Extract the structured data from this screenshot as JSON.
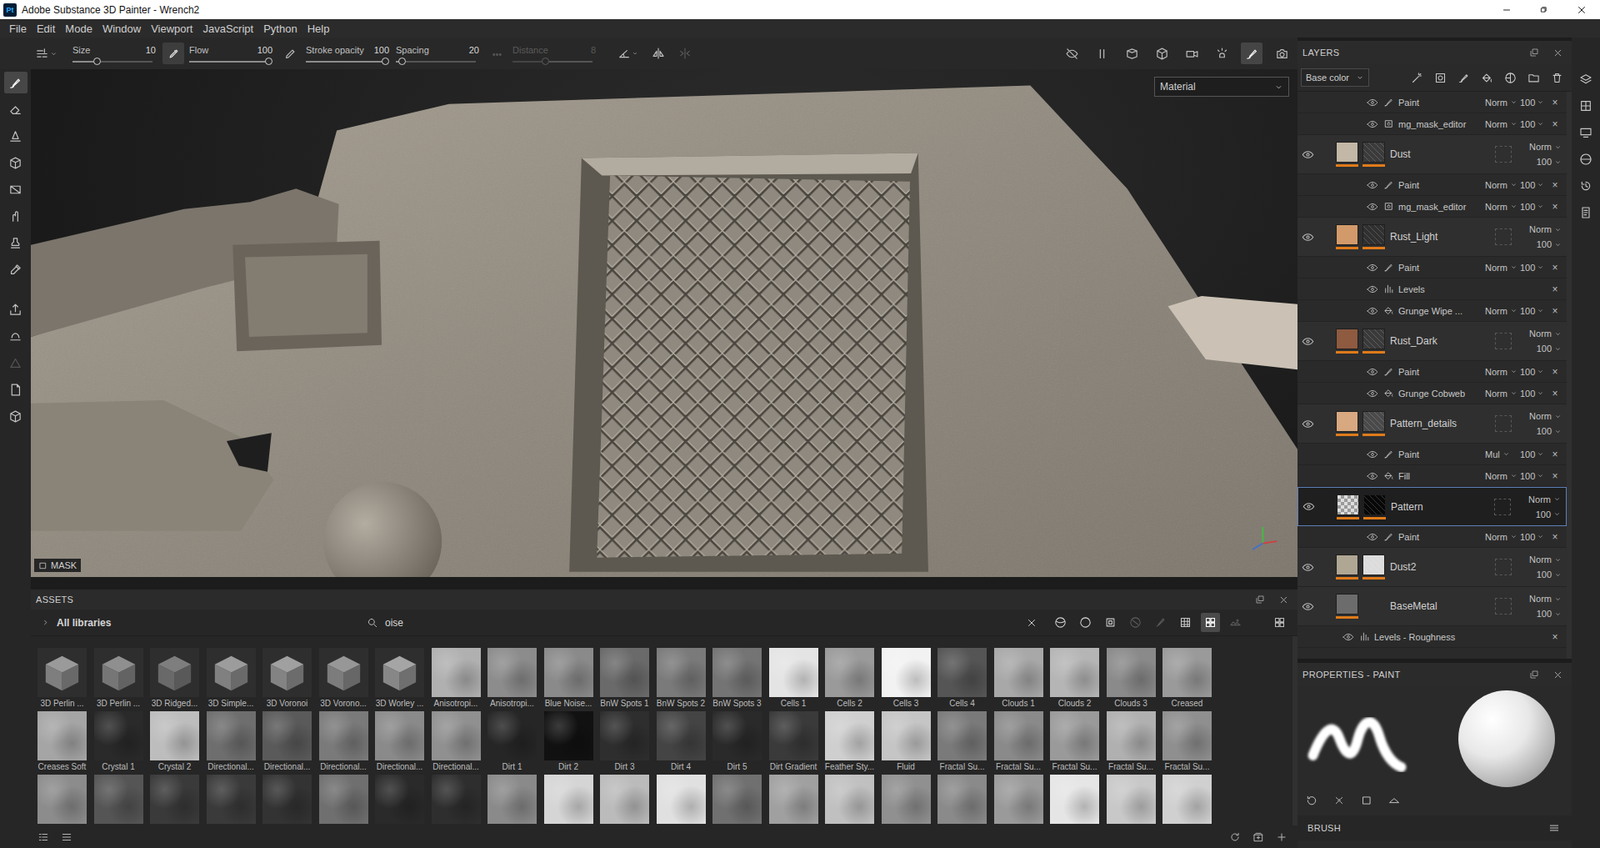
{
  "window": {
    "title": "Adobe Substance 3D Painter - Wrench2",
    "logo": "Pt"
  },
  "menu": [
    "File",
    "Edit",
    "Mode",
    "Window",
    "Viewport",
    "JavaScript",
    "Python",
    "Help"
  ],
  "toolbar": {
    "sliders": [
      {
        "label": "Size",
        "value": "10",
        "level": 0.31,
        "disabled": false,
        "toggle": null
      },
      {
        "label": "Flow",
        "value": "100",
        "level": 1,
        "disabled": false,
        "toggle": true
      },
      {
        "label": "Stroke opacity",
        "value": "100",
        "level": 1,
        "disabled": false,
        "toggle": false
      },
      {
        "label": "Spacing",
        "value": "20",
        "level": 0.08,
        "disabled": false,
        "toggle": null
      },
      {
        "label": "Distance",
        "value": "8",
        "level": 0.42,
        "disabled": true,
        "toggle": false
      }
    ],
    "extras": [
      {
        "disabled": false
      },
      {
        "disabled": false
      },
      {
        "disabled": true
      }
    ],
    "view_tools": [
      {
        "selected": false
      },
      {
        "selected": false
      },
      {
        "selected": false
      },
      {
        "selected": false
      },
      {
        "selected": false
      },
      {
        "selected": false
      },
      {
        "selected": true
      },
      {
        "selected": false
      }
    ]
  },
  "tools": [
    {
      "selected": true,
      "disabled": false
    },
    {
      "selected": false,
      "disabled": false
    },
    {
      "selected": false,
      "disabled": false
    },
    {
      "selected": false,
      "disabled": false
    },
    {
      "selected": false,
      "disabled": false
    },
    {
      "selected": false,
      "disabled": false
    },
    {
      "selected": false,
      "disabled": false
    },
    {
      "selected": false,
      "disabled": false
    },
    {
      "selected": false,
      "disabled": false
    },
    {
      "selected": false,
      "disabled": false
    },
    {
      "selected": false,
      "disabled": true
    },
    {
      "selected": false,
      "disabled": false
    },
    {
      "selected": false,
      "disabled": false
    }
  ],
  "viewport": {
    "mode": "Material",
    "mask_label": "MASK"
  },
  "assets": {
    "title": "ASSETS",
    "library": "All libraries",
    "search": "oise",
    "filters": [
      {
        "selected": false,
        "disabled": false
      },
      {
        "selected": false,
        "disabled": false
      },
      {
        "selected": false,
        "disabled": false
      },
      {
        "selected": false,
        "disabled": true
      },
      {
        "selected": false,
        "disabled": true
      },
      {
        "selected": false,
        "disabled": false
      },
      {
        "selected": true,
        "disabled": false
      },
      {
        "selected": false,
        "disabled": true
      }
    ],
    "items": [
      {
        "label": "3D Perlin ...",
        "color": "#9a9a9a",
        "kind": "3d"
      },
      {
        "label": "3D Perlin ...",
        "color": "#8f8f8f",
        "kind": "3d"
      },
      {
        "label": "3D Ridged...",
        "color": "#7e7e7e",
        "kind": "3d"
      },
      {
        "label": "3D Simple...",
        "color": "#9c9c9c",
        "kind": "3d"
      },
      {
        "label": "3D Voronoi",
        "color": "#a0a0a0",
        "kind": "3d"
      },
      {
        "label": "3D Vorono...",
        "color": "#979797",
        "kind": "3d"
      },
      {
        "label": "3D Worley ...",
        "color": "#a5a5a5",
        "kind": "3d"
      },
      {
        "label": "Anisotropi...",
        "color": "#b0b0b0",
        "kind": "2d"
      },
      {
        "label": "Anisotropi...",
        "color": "#8c8c8c",
        "kind": "2d"
      },
      {
        "label": "Blue Noise...",
        "color": "#8a8a8a",
        "kind": "2d"
      },
      {
        "label": "BnW Spots 1",
        "color": "#6a6a6a",
        "kind": "2d"
      },
      {
        "label": "BnW Spots 2",
        "color": "#7a7a7a",
        "kind": "2d"
      },
      {
        "label": "BnW Spots 3",
        "color": "#747474",
        "kind": "2d"
      },
      {
        "label": "Cells 1",
        "color": "#e4e4e4",
        "kind": "2d"
      },
      {
        "label": "Cells 2",
        "color": "#9a9a9a",
        "kind": "2d"
      },
      {
        "label": "Cells 3",
        "color": "#f2f2f2",
        "kind": "2d"
      },
      {
        "label": "Cells 4",
        "color": "#555555",
        "kind": "2d"
      },
      {
        "label": "Clouds 1",
        "color": "#a8a8a8",
        "kind": "2d"
      },
      {
        "label": "Clouds 2",
        "color": "#b5b5b5",
        "kind": "2d"
      },
      {
        "label": "Clouds 3",
        "color": "#8a8a8a",
        "kind": "2d"
      },
      {
        "label": "Creased",
        "color": "#9a9a9a",
        "kind": "2d"
      },
      {
        "label": "Creases Soft",
        "color": "#a5a5a5",
        "kind": "2d"
      },
      {
        "label": "Crystal 1",
        "color": "#2a2a2a",
        "kind": "2d"
      },
      {
        "label": "Crystal 2",
        "color": "#bdbdbd",
        "kind": "2d"
      },
      {
        "label": "Directional...",
        "color": "#6e6e6e",
        "kind": "2d"
      },
      {
        "label": "Directional...",
        "color": "#5a5a5a",
        "kind": "2d"
      },
      {
        "label": "Directional...",
        "color": "#7a7a7a",
        "kind": "2d"
      },
      {
        "label": "Directional...",
        "color": "#8a8a8a",
        "kind": "2d"
      },
      {
        "label": "Directional...",
        "color": "#909090",
        "kind": "2d"
      },
      {
        "label": "Dirt 1",
        "color": "#262626",
        "kind": "2d"
      },
      {
        "label": "Dirt 2",
        "color": "#111111",
        "kind": "2d"
      },
      {
        "label": "Dirt 3",
        "color": "#2e2e2e",
        "kind": "2d"
      },
      {
        "label": "Dirt 4",
        "color": "#444444",
        "kind": "2d"
      },
      {
        "label": "Dirt 5",
        "color": "#2a2a2a",
        "kind": "2d"
      },
      {
        "label": "Dirt Gradient",
        "color": "#3a3a3a",
        "kind": "2d"
      },
      {
        "label": "Feather Sty...",
        "color": "#cfcfcf",
        "kind": "2d"
      },
      {
        "label": "Fluid",
        "color": "#c5c5c5",
        "kind": "2d"
      },
      {
        "label": "Fractal Su...",
        "color": "#7a7a7a",
        "kind": "2d"
      },
      {
        "label": "Fractal Su...",
        "color": "#8a8a8a",
        "kind": "2d"
      },
      {
        "label": "Fractal Su...",
        "color": "#9a9a9a",
        "kind": "2d"
      },
      {
        "label": "Fractal Su...",
        "color": "#b0b0b0",
        "kind": "2d"
      },
      {
        "label": "Fractal Su...",
        "color": "#8f8f8f",
        "kind": "2d"
      }
    ],
    "cut_row": [
      {
        "color": "#8c8c8c"
      },
      {
        "color": "#555555"
      },
      {
        "color": "#3a3a3a"
      },
      {
        "color": "#3a3a3a"
      },
      {
        "color": "#333333"
      },
      {
        "color": "#6f6f6f"
      },
      {
        "color": "#2a2a2a"
      },
      {
        "color": "#2e2e2e"
      },
      {
        "color": "#8a8a8a"
      },
      {
        "color": "#d5d5d5"
      },
      {
        "color": "#bbbbbb"
      },
      {
        "color": "#e0e0e0"
      },
      {
        "color": "#707070"
      },
      {
        "color": "#a0a0a0"
      },
      {
        "color": "#c0c0c0"
      },
      {
        "color": "#909090"
      },
      {
        "color": "#8a8a8a"
      },
      {
        "color": "#9a9a9a"
      },
      {
        "color": "#e5e5e5"
      },
      {
        "color": "#c8c8c8"
      },
      {
        "color": "#d0d0d0"
      }
    ]
  },
  "layers": {
    "title": "LAYERS",
    "channel": "Base color",
    "remove_glyph": "×",
    "rows": [
      {
        "kind": "effect",
        "name": "Paint",
        "icon": "paint",
        "blend": "Norm",
        "opacity": "100",
        "visible": true,
        "depth": 2
      },
      {
        "kind": "effect",
        "name": "mg_mask_editor",
        "icon": "mask",
        "blend": "Norm",
        "opacity": "100",
        "visible": true,
        "depth": 2
      },
      {
        "kind": "layer",
        "name": "Dust",
        "color": "#c3b7a5",
        "mask_color": "#3b3b3b",
        "transparent": false,
        "blend": "Norm",
        "opacity": "100",
        "visible": true,
        "selected": false
      },
      {
        "kind": "effect",
        "name": "Paint",
        "icon": "paint",
        "blend": "Norm",
        "opacity": "100",
        "visible": true,
        "depth": 2
      },
      {
        "kind": "effect",
        "name": "mg_mask_editor",
        "icon": "mask",
        "blend": "Norm",
        "opacity": "100",
        "visible": true,
        "depth": 2
      },
      {
        "kind": "layer",
        "name": "Rust_Light",
        "color": "#d29a6a",
        "mask_color": "#303030",
        "transparent": false,
        "blend": "Norm",
        "opacity": "100",
        "visible": true,
        "selected": false
      },
      {
        "kind": "effect",
        "name": "Paint",
        "icon": "paint",
        "blend": "Norm",
        "opacity": "100",
        "visible": true,
        "depth": 2
      },
      {
        "kind": "effect",
        "name": "Levels",
        "icon": "levels",
        "blend": null,
        "opacity": null,
        "visible": true,
        "depth": 2
      },
      {
        "kind": "effect",
        "name": "Grunge Wipe ...",
        "icon": "fill",
        "blend": "Norm",
        "opacity": "100",
        "visible": true,
        "depth": 2
      },
      {
        "kind": "layer",
        "name": "Rust_Dark",
        "color": "#8e5a40",
        "mask_color": "#3a3a3a",
        "transparent": false,
        "blend": "Norm",
        "opacity": "100",
        "visible": true,
        "selected": false
      },
      {
        "kind": "effect",
        "name": "Paint",
        "icon": "paint",
        "blend": "Norm",
        "opacity": "100",
        "visible": true,
        "depth": 2
      },
      {
        "kind": "effect",
        "name": "Grunge Cobweb",
        "icon": "fill",
        "blend": "Norm",
        "opacity": "100",
        "visible": true,
        "depth": 2
      },
      {
        "kind": "layer",
        "name": "Pattern_details",
        "color": "#d8a880",
        "mask_color": "#4a4a4a",
        "transparent": false,
        "blend": "Norm",
        "opacity": "100",
        "visible": true,
        "selected": false
      },
      {
        "kind": "effect",
        "name": "Paint",
        "icon": "paint",
        "blend": "Mul",
        "opacity": "100",
        "visible": true,
        "depth": 2
      },
      {
        "kind": "effect",
        "name": "Fill",
        "icon": "fill",
        "blend": "Norm",
        "opacity": "100",
        "visible": true,
        "depth": 2
      },
      {
        "kind": "layer",
        "name": "Pattern",
        "color": "#cccccc",
        "mask_color": "#080808",
        "transparent": true,
        "blend": "Norm",
        "opacity": "100",
        "visible": true,
        "selected": true
      },
      {
        "kind": "effect",
        "name": "Paint",
        "icon": "paint",
        "blend": "Norm",
        "opacity": "100",
        "visible": true,
        "depth": 2
      },
      {
        "kind": "layer",
        "name": "Dust2",
        "color": "#b0a694",
        "mask_color": "#dcdcdc",
        "transparent": false,
        "blend": "Norm",
        "opacity": "100",
        "visible": true,
        "selected": false
      },
      {
        "kind": "layer",
        "name": "BaseMetal",
        "color": "#6c6c6c",
        "mask_color": null,
        "transparent": false,
        "blend": "Norm",
        "opacity": "100",
        "visible": true,
        "selected": false
      },
      {
        "kind": "effect",
        "name": "Levels - Roughness",
        "icon": "levels",
        "blend": null,
        "opacity": null,
        "visible": true,
        "depth": 1
      }
    ]
  },
  "properties": {
    "title": "PROPERTIES - PAINT",
    "section": "BRUSH"
  }
}
